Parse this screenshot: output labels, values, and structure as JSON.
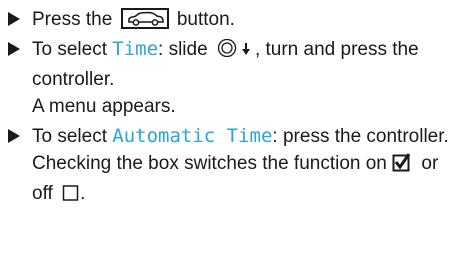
{
  "steps": [
    {
      "pre": "Press the ",
      "icon": "car-button-icon",
      "post": " button."
    },
    {
      "pre": "To select ",
      "highlight": "Time",
      "mid": ": slide ",
      "icon1": "controller-icon",
      "icon2": "arrow-down-icon",
      "post": ", turn and press the controller.",
      "result": "A menu appears."
    },
    {
      "pre": "To select ",
      "highlight": "Automatic Time",
      "post": ": press the controller.",
      "result_pre": "Checking the box switches the function on ",
      "icon_on": "checkbox-checked-icon",
      "result_mid": " or off ",
      "icon_off": "checkbox-empty-icon",
      "result_post": "."
    }
  ],
  "colors": {
    "highlight": "#2aa6d8",
    "text": "#1a1a1a"
  }
}
